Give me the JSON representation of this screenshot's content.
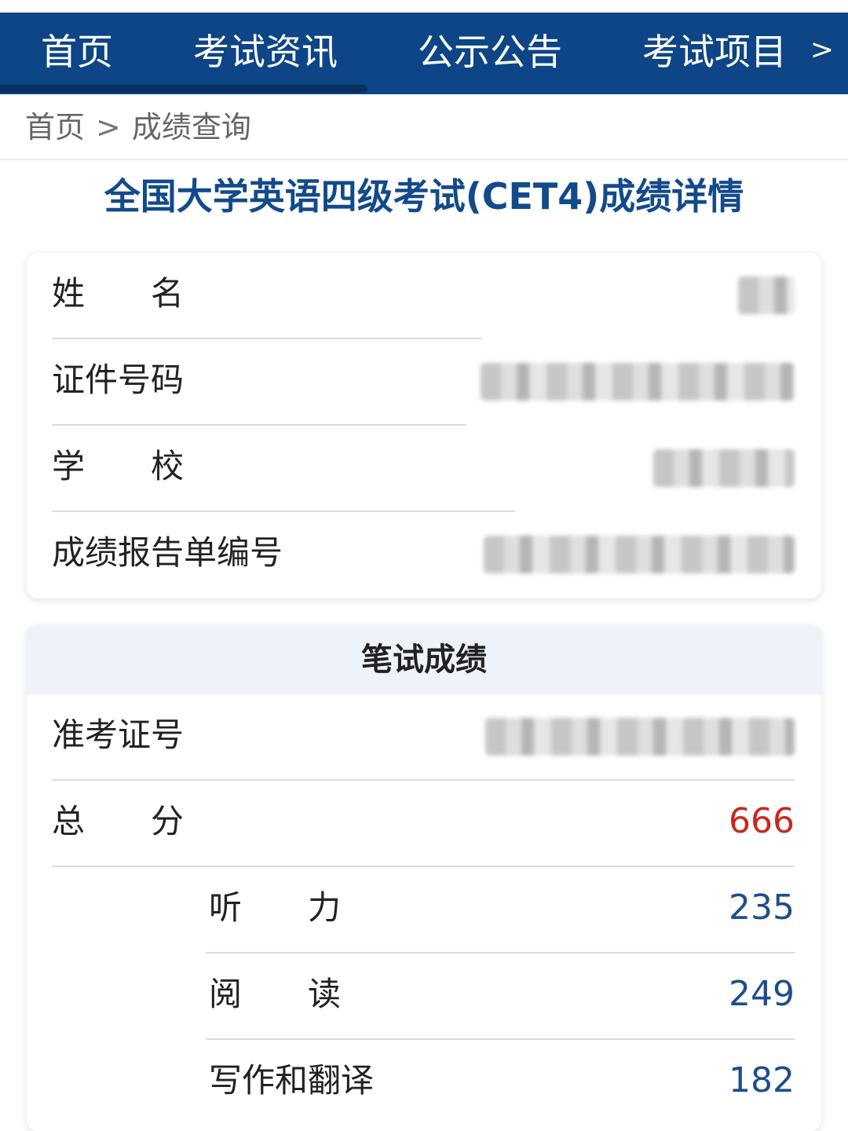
{
  "nav": {
    "items": [
      "首页",
      "考试资讯",
      "公示公告",
      "考试项目"
    ],
    "more": ">"
  },
  "breadcrumb": {
    "home": "首页",
    "separator": ">",
    "current": "成绩查询"
  },
  "page_title": "全国大学英语四级考试(CET4)成绩详情",
  "personal_info": {
    "rows": [
      {
        "label": "姓　　名",
        "value": "(masked)"
      },
      {
        "label": "证件号码",
        "value": "(masked)"
      },
      {
        "label": "学　　校",
        "value": "(masked)"
      },
      {
        "label": "成绩报告单编号",
        "value": "(masked)"
      }
    ]
  },
  "written_scores": {
    "header": "笔试成绩",
    "admission_label": "准考证号",
    "admission_value": "(masked)",
    "total_label": "总　　分",
    "total_value": "666",
    "sub_scores": [
      {
        "label": "听　　力",
        "value": "235"
      },
      {
        "label": "阅　　读",
        "value": "249"
      },
      {
        "label": "写作和翻译",
        "value": "182"
      }
    ]
  },
  "colors": {
    "nav_bg": "#0d4586",
    "title": "#124a8a",
    "total_score": "#c8281f",
    "sub_score": "#1c4e8c"
  }
}
